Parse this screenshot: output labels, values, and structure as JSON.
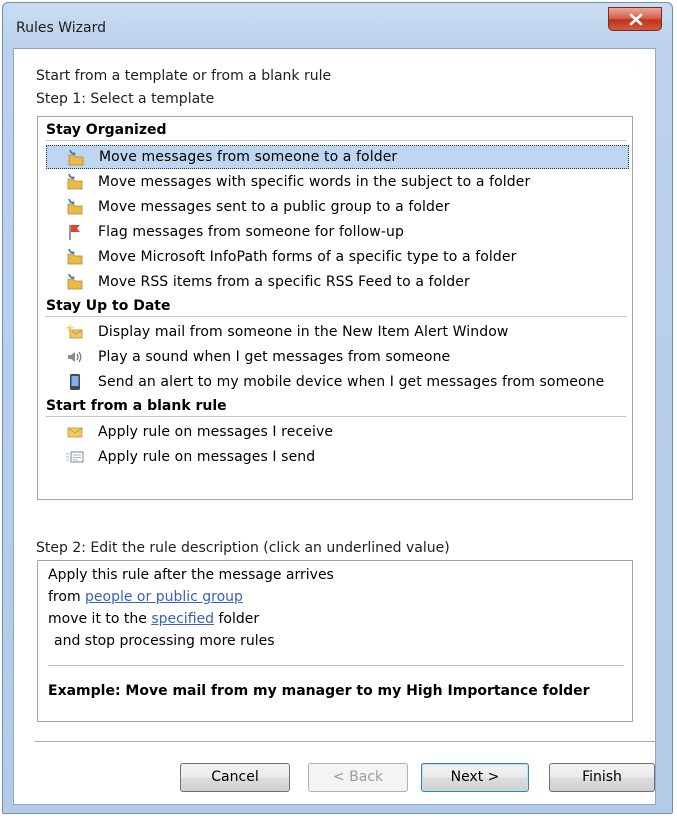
{
  "window": {
    "title": "Rules Wizard"
  },
  "intro": {
    "line1": "Start from a template or from a blank rule",
    "line2": "Step 1: Select a template"
  },
  "templates": {
    "groups": [
      {
        "header": "Stay Organized",
        "items": [
          {
            "label": "Move messages from someone to a folder",
            "icon": "folder-move-icon",
            "selected": true
          },
          {
            "label": "Move messages with specific words in the subject to a folder",
            "icon": "folder-move-icon"
          },
          {
            "label": "Move messages sent to a public group to a folder",
            "icon": "folder-move-icon"
          },
          {
            "label": "Flag messages from someone for follow-up",
            "icon": "flag-icon"
          },
          {
            "label": "Move Microsoft InfoPath forms of a specific type to a folder",
            "icon": "folder-move-icon"
          },
          {
            "label": "Move RSS items from a specific RSS Feed to a folder",
            "icon": "folder-move-icon"
          }
        ]
      },
      {
        "header": "Stay Up to Date",
        "items": [
          {
            "label": "Display mail from someone in the New Item Alert Window",
            "icon": "alert-envelope-icon"
          },
          {
            "label": "Play a sound when I get messages from someone",
            "icon": "speaker-icon"
          },
          {
            "label": "Send an alert to my mobile device when I get messages from someone",
            "icon": "mobile-device-icon"
          }
        ]
      },
      {
        "header": "Start from a blank rule",
        "items": [
          {
            "label": "Apply rule on messages I receive",
            "icon": "envelope-receive-icon"
          },
          {
            "label": "Apply rule on messages I send",
            "icon": "envelope-send-icon"
          }
        ]
      }
    ]
  },
  "step2": {
    "label": "Step 2: Edit the rule description (click an underlined value)",
    "line1": "Apply this rule after the message arrives",
    "line2_prefix": "from ",
    "line2_link": "people or public group",
    "line3_prefix": "move it to the ",
    "line3_link": "specified",
    "line3_suffix": " folder",
    "line4": "and stop processing more rules",
    "example": "Example: Move mail from my manager to my High Importance folder"
  },
  "buttons": {
    "cancel": "Cancel",
    "back": "< Back",
    "next": "Next >",
    "finish": "Finish"
  },
  "colors": {
    "selection": "#bfd6f0",
    "link": "#3762b5",
    "close_button": "#c8452c"
  }
}
